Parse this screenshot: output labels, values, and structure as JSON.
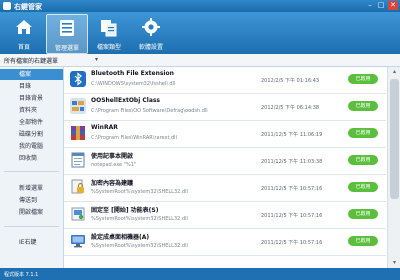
{
  "window": {
    "title": "右鍵管家",
    "min_glyph": "–",
    "max_glyph": "□",
    "close_glyph": "✕"
  },
  "toolbar": {
    "items": [
      {
        "label": "首頁",
        "icon": "home-icon"
      },
      {
        "label": "管理選單",
        "icon": "menu-list-icon",
        "active": true
      },
      {
        "label": "檔案類型",
        "icon": "file-type-icon"
      },
      {
        "label": "軟體設置",
        "icon": "gear-icon"
      }
    ]
  },
  "filter": {
    "label": "所有檔案的右鍵選單",
    "arrow": "▾"
  },
  "sidebar": {
    "items": [
      {
        "label": "檔案",
        "active": true
      },
      {
        "label": "目錄"
      },
      {
        "label": "目錄背景"
      },
      {
        "label": "資料夾"
      },
      {
        "label": "全部物件"
      },
      {
        "label": "磁碟分割"
      },
      {
        "label": "我的電腦"
      },
      {
        "label": "回收筒"
      },
      {
        "label": "新增選單"
      },
      {
        "label": "傳送到"
      },
      {
        "label": "開啟檔案"
      },
      {
        "label": "IE右鍵"
      }
    ]
  },
  "list": {
    "rows": [
      {
        "name": "Bluetooth File Extension",
        "path": "C:\\WINDOWS\\system32\\fsshell.dll",
        "date": "2012/2/5 下午 01:16:43",
        "status": "已啟用",
        "icon": "bluetooth-icon"
      },
      {
        "name": "OOShellExtObj Class",
        "path": "C:\\Program Files\\OO Software\\Defrag\\oodsh.dll",
        "date": "2012/2/5 下午 06:14:38",
        "status": "已啟用",
        "icon": "defrag-icon"
      },
      {
        "name": "WinRAR",
        "path": "C:\\Program Files\\WinRAR\\rarext.dll",
        "date": "2011/12/5 下午 11:06:19",
        "status": "已啟用",
        "icon": "winrar-icon"
      },
      {
        "name": "使用記事本開啟",
        "path": "notepad.exe \"%1\"",
        "date": "2011/12/5 下午 11:03:38",
        "status": "已啟用",
        "icon": "notepad-icon"
      },
      {
        "name": "加密內容為建議",
        "path": "%SystemRoot%\\system32\\SHELL32.dll",
        "date": "2011/12/5 下午 10:57:16",
        "status": "已啟用",
        "icon": "encrypt-icon"
      },
      {
        "name": "固定至 [開始] 功能表(S)",
        "path": "%SystemRoot%\\system32\\SHELL32.dll",
        "date": "2011/12/5 下午 10:57:16",
        "status": "已啟用",
        "icon": "pin-start-icon"
      },
      {
        "name": "設定成桌面相機器(A)",
        "path": "%SystemRoot%\\system32\\SHELL32.dll",
        "date": "2011/12/5 下午 10:57:16",
        "status": "已啟用",
        "icon": "desktop-icon"
      }
    ]
  },
  "scrollbar": {
    "up_glyph": "▴",
    "down_glyph": "▾"
  },
  "status": {
    "text": "程式版本 7.1.1"
  },
  "colors": {
    "accent": "#2f87c9",
    "enabled_green": "#5bbf3d",
    "sidebar_active": "#3a8fd2"
  }
}
